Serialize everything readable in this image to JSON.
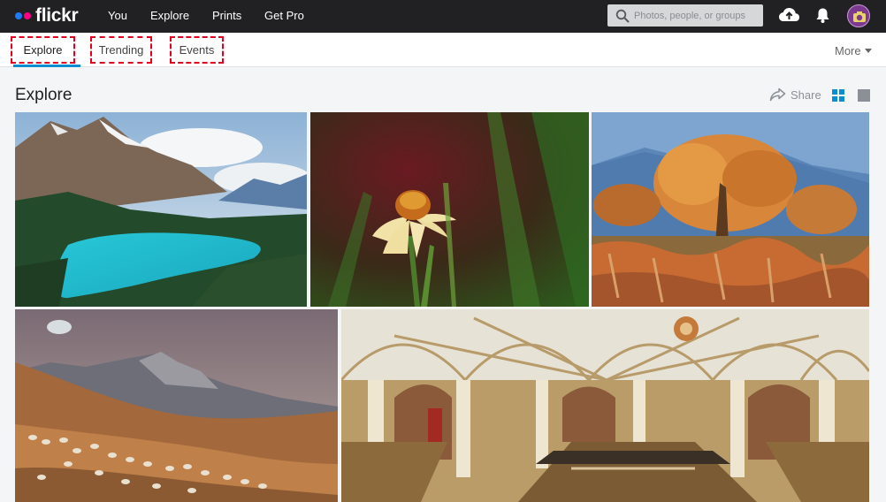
{
  "topbar": {
    "logo_text": "flickr",
    "nav": [
      {
        "label": "You"
      },
      {
        "label": "Explore"
      },
      {
        "label": "Prints"
      },
      {
        "label": "Get Pro"
      }
    ],
    "search": {
      "placeholder": "Photos, people, or groups",
      "value": ""
    },
    "icons": [
      "search-icon",
      "upload-cloud-icon",
      "notification-bell-icon",
      "avatar"
    ]
  },
  "subnav": {
    "tabs": [
      {
        "label": "Explore",
        "active": true
      },
      {
        "label": "Trending",
        "active": false
      },
      {
        "label": "Events",
        "active": false
      }
    ],
    "more_label": "More",
    "accent_color": "#0b8ecf",
    "highlight_color": "#e1001d"
  },
  "main": {
    "title": "Explore",
    "share_label": "Share",
    "view_modes": [
      "grid-view",
      "single-view"
    ],
    "photos": [
      {
        "subject": "mountain-lake"
      },
      {
        "subject": "coneflower"
      },
      {
        "subject": "autumn-tree"
      },
      {
        "subject": "sheep-hills"
      },
      {
        "subject": "vaulted-hall"
      }
    ]
  },
  "colors": {
    "topbar_bg": "#212124",
    "flickr_blue": "#1d7bf5",
    "flickr_pink": "#ff0084",
    "page_bg": "#f3f5f6"
  }
}
